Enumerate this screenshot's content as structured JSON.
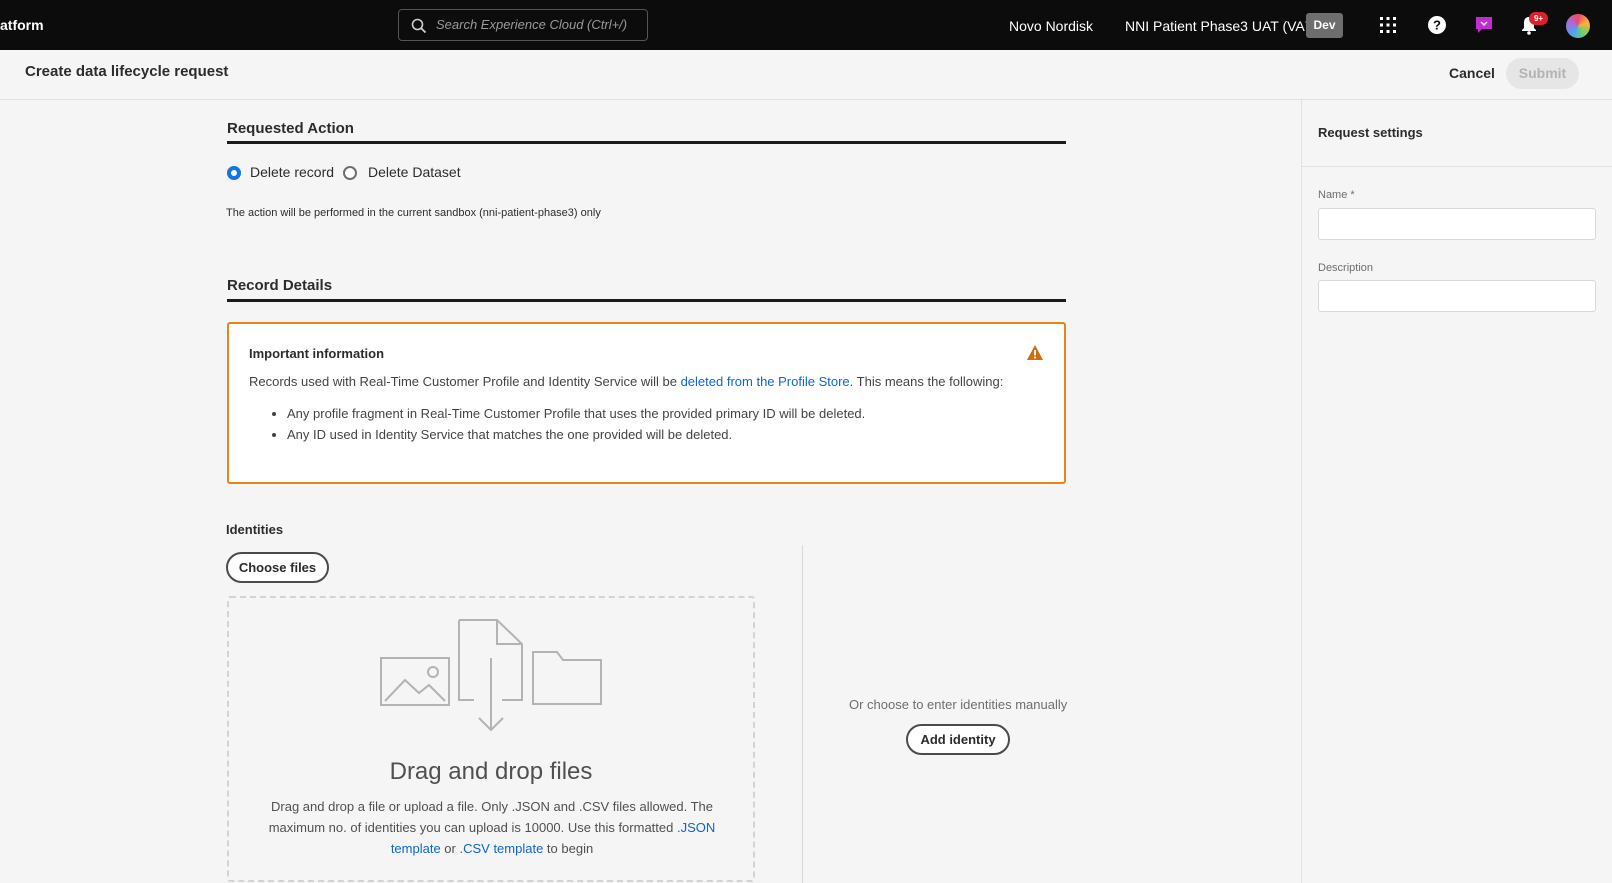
{
  "topbar": {
    "brand": "atform",
    "search_placeholder": "Search Experience Cloud (Ctrl+/)",
    "org": "Novo Nordisk",
    "sandbox": "NNI Patient Phase3 UAT (VA7)",
    "env_badge": "Dev",
    "notifications_badge": "9+"
  },
  "header": {
    "title": "Create data lifecycle request",
    "cancel": "Cancel",
    "submit": "Submit"
  },
  "requested_action": {
    "heading": "Requested Action",
    "options": [
      {
        "label": "Delete record",
        "selected": true
      },
      {
        "label": "Delete Dataset",
        "selected": false
      }
    ],
    "note": "The action will be performed in the current sandbox (nni-patient-phase3) only"
  },
  "record_details": {
    "heading": "Record Details",
    "info": {
      "title": "Important information",
      "text_before": "Records used with Real-Time Customer Profile and Identity Service will be ",
      "link": "deleted from the Profile Store",
      "text_after": ". This means the following:",
      "bullets": [
        "Any profile fragment in Real-Time Customer Profile that uses the provided primary ID will be deleted.",
        "Any ID used in Identity Service that matches the one provided will be deleted."
      ]
    }
  },
  "identities": {
    "heading": "Identities",
    "choose_files": "Choose files",
    "drop_title": "Drag and drop files",
    "drop_text_1": "Drag and drop a file or upload a file. Only .JSON and .CSV files allowed. The maximum no. of identities you can upload is 10000. Use this formatted ",
    "json_link": ".JSON template",
    "drop_text_2": " or ",
    "csv_link": ".CSV template",
    "drop_text_3": " to begin",
    "manual_text": "Or choose to enter identities manually",
    "add_identity": "Add identity"
  },
  "settings": {
    "heading": "Request settings",
    "name_label": "Name *",
    "description_label": "Description"
  },
  "colors": {
    "accent": "#1473e6",
    "link": "#0d66d0",
    "warning": "#e68619"
  }
}
